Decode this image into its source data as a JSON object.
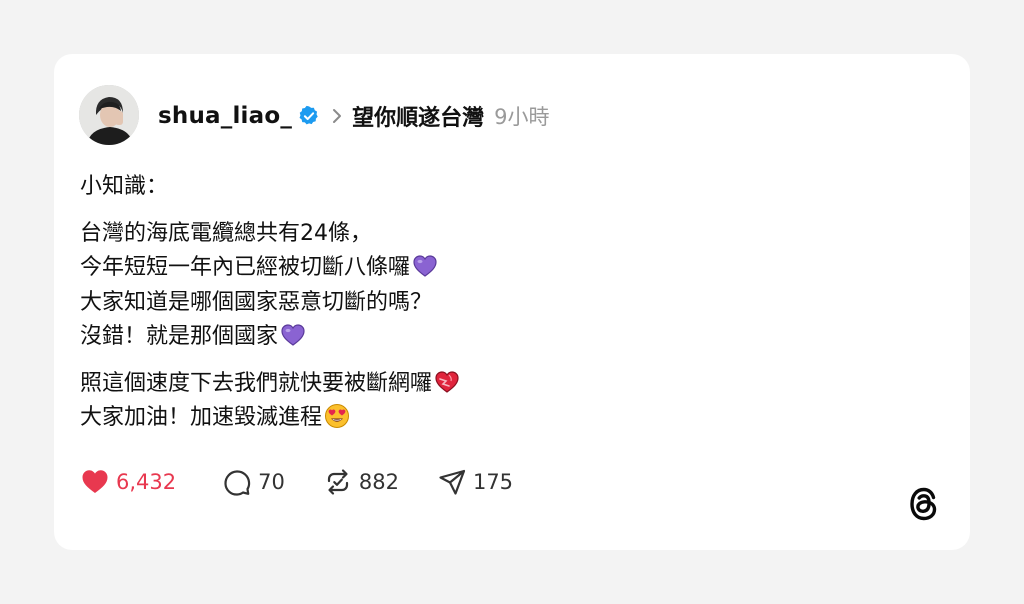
{
  "post": {
    "username": "shua_liao_",
    "verified": true,
    "topic": "望你順遂台灣",
    "time": "9小時",
    "body": [
      {
        "lines": [
          {
            "text": "小知識：",
            "emoji": ""
          }
        ]
      },
      {
        "lines": [
          {
            "text": "台灣的海底電纜總共有24條，",
            "emoji": ""
          },
          {
            "text": "今年短短一年內已經被切斷八條囉",
            "emoji": "purple-heart"
          },
          {
            "text": "大家知道是哪個國家惡意切斷的嗎？",
            "emoji": ""
          },
          {
            "text": "沒錯！就是那個國家",
            "emoji": "purple-heart"
          }
        ]
      },
      {
        "lines": [
          {
            "text": "照這個速度下去我們就快要被斷網囉",
            "emoji": "heart-on-fire"
          },
          {
            "text": "大家加油！加速毀滅進程",
            "emoji": "heart-eyes"
          }
        ]
      }
    ]
  },
  "actions": {
    "likes": "6,432",
    "replies": "70",
    "reposts": "882",
    "shares": "175"
  },
  "colors": {
    "like": "#e8384f",
    "verified": "#1d9bf0",
    "purple_heart": "#8a63d2",
    "time": "#9a9a9a"
  },
  "icons": {
    "verified": "verified-badge-icon",
    "chevron": "chevron-right-icon",
    "like": "heart-icon",
    "reply": "comment-icon",
    "repost": "repost-icon",
    "share": "send-icon",
    "logo": "threads-logo-icon"
  }
}
